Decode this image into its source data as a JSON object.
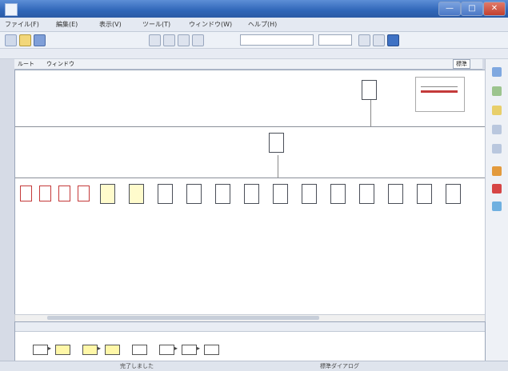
{
  "window": {
    "title": "",
    "close_label": "✕",
    "max_label": "□",
    "min_label": "—"
  },
  "menu": [
    "ファイル(F)",
    "編集(E)",
    "表示(V)",
    "ツール(T)",
    "ウィンドウ(W)",
    "ヘルプ(H)"
  ],
  "tabs": [
    "ルート",
    "ウィンドウ"
  ],
  "right_combo": "標準",
  "status": {
    "left": "完了しました",
    "right": "標準ダイアログ"
  },
  "colors": {
    "titlebar": "#2f66b8",
    "accent_red": "#c43a3a",
    "accent_yellow": "#fffbcc"
  },
  "icons": [
    "app-icon",
    "new-icon",
    "open-icon",
    "save-icon",
    "undo-icon",
    "redo-icon"
  ]
}
